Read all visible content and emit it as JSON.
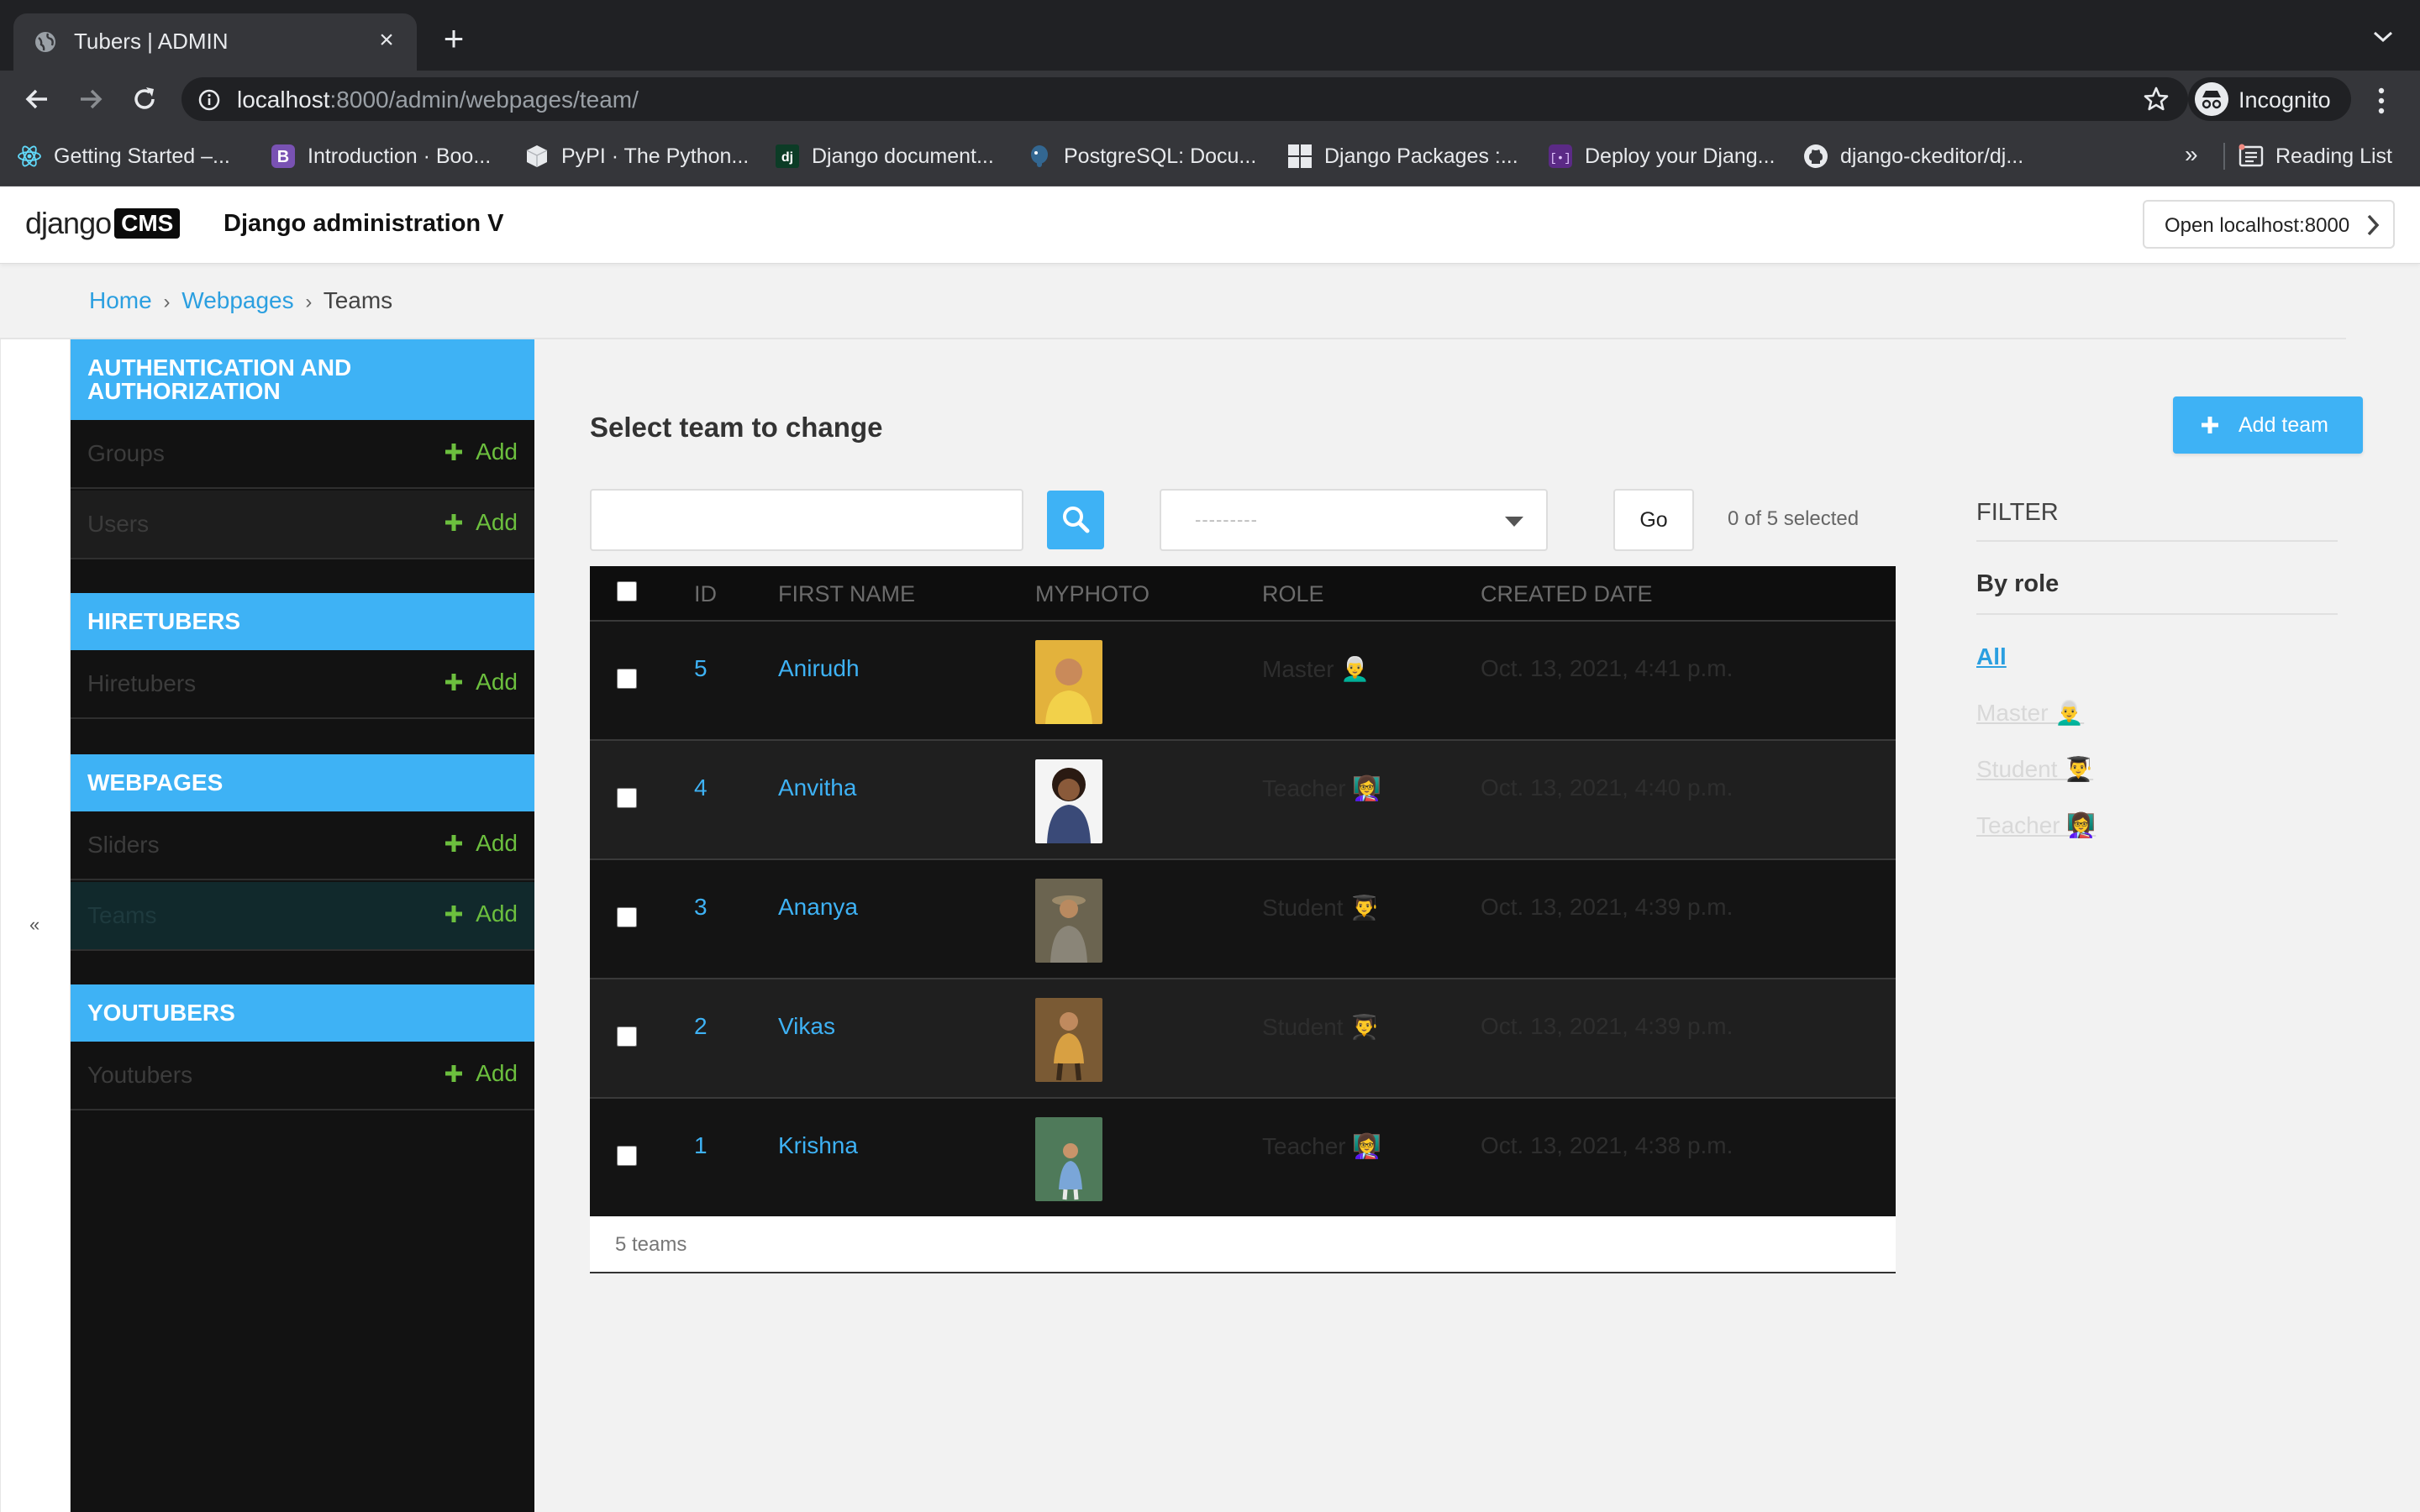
{
  "browser": {
    "tab_title": "Tubers | ADMIN",
    "url_host": "localhost",
    "url_rest": ":8000/admin/webpages/team/",
    "profile_label": "Incognito",
    "bookmarks": [
      {
        "label": "Getting Started –...",
        "icon": "react-icon"
      },
      {
        "label": "Introduction · Boo...",
        "icon": "bootstrap-icon"
      },
      {
        "label": "PyPI · The Python...",
        "icon": "pypi-icon"
      },
      {
        "label": "Django document...",
        "icon": "django-icon"
      },
      {
        "label": "PostgreSQL: Docu...",
        "icon": "postgresql-icon"
      },
      {
        "label": "Django Packages :...",
        "icon": "django-packages-icon"
      },
      {
        "label": "Deploy your Djang...",
        "icon": "deploy-icon"
      },
      {
        "label": "django-ckeditor/dj...",
        "icon": "github-icon"
      }
    ],
    "more_label": "»",
    "reading_list_label": "Reading List"
  },
  "cms": {
    "logo_text": "django",
    "logo_badge": "CMS",
    "site_title": "Django administration V",
    "open_button": "Open localhost:8000"
  },
  "breadcrumbs": {
    "home": "Home",
    "app": "Webpages",
    "current": "Teams",
    "sep": "›"
  },
  "sidebar": {
    "collapse_label": "«",
    "add_label": "Add",
    "apps": [
      {
        "name": "AUTHENTICATION AND AUTHORIZATION",
        "models": [
          "Groups",
          "Users"
        ]
      },
      {
        "name": "HIRETUBERS",
        "models": [
          "Hiretubers"
        ]
      },
      {
        "name": "WEBPAGES",
        "models": [
          "Sliders",
          "Teams"
        ]
      },
      {
        "name": "YOUTUBERS",
        "models": [
          "Youtubers"
        ]
      }
    ]
  },
  "main": {
    "title": "Select team to change",
    "add_button": "Add team",
    "search_placeholder": "",
    "action_placeholder": "---------",
    "go_label": "Go",
    "selected_count": "0 of 5 selected",
    "columns": [
      "ID",
      "FIRST NAME",
      "MYPHOTO",
      "ROLE",
      "CREATED DATE"
    ],
    "rows": [
      {
        "id": "5",
        "first_name": "Anirudh",
        "role": "Master 👨‍🦳",
        "created": "Oct. 13, 2021, 4:41 p.m.",
        "photo_color": "#e3b23c"
      },
      {
        "id": "4",
        "first_name": "Anvitha",
        "role": "Teacher 👩‍🏫",
        "created": "Oct. 13, 2021, 4:40 p.m.",
        "photo_color": "#3a4a78"
      },
      {
        "id": "3",
        "first_name": "Ananya",
        "role": "Student 👨‍🎓",
        "created": "Oct. 13, 2021, 4:39 p.m.",
        "photo_color": "#6b6450"
      },
      {
        "id": "2",
        "first_name": "Vikas",
        "role": "Student 👨‍🎓",
        "created": "Oct. 13, 2021, 4:39 p.m.",
        "photo_color": "#7a5a34"
      },
      {
        "id": "1",
        "first_name": "Krishna",
        "role": "Teacher 👩‍🏫",
        "created": "Oct. 13, 2021, 4:38 p.m.",
        "photo_color": "#4f7a5a"
      }
    ],
    "footer": "5 teams"
  },
  "filter": {
    "title": "FILTER",
    "heading": "By role",
    "options": [
      "All",
      "Master 👨‍🦳",
      "Student 👨‍🎓",
      "Teacher 👩‍🏫"
    ]
  },
  "colors": {
    "accent": "#3eb2f5",
    "add_green": "#6cbf3e",
    "table_bg": "#141414"
  }
}
